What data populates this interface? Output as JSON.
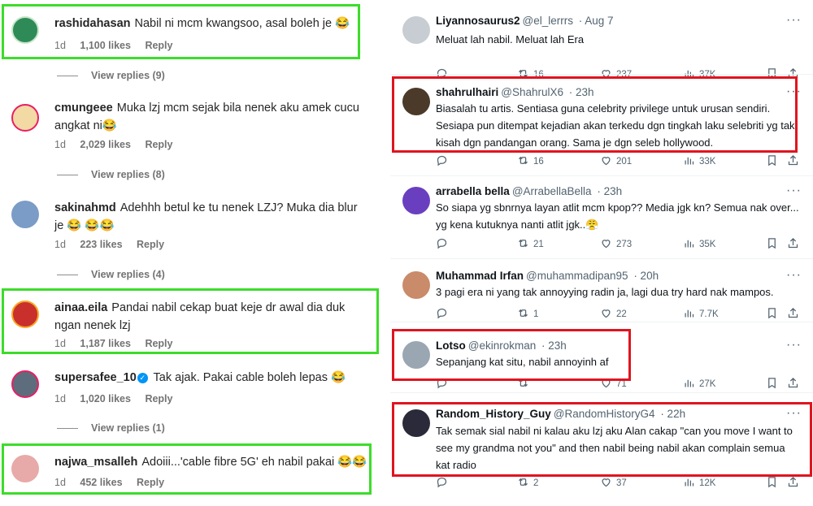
{
  "instagram": {
    "comments": [
      {
        "username": "rashidahasan",
        "text": "Nabil ni mcm kwangsoo, asal boleh je 😂",
        "time": "1d",
        "likes": "1,100 likes",
        "reply": "Reply",
        "view_replies": "View replies (9)"
      },
      {
        "username": "cmungeee",
        "text": "Muka lzj mcm sejak bila nenek aku amek cucu angkat ni😂",
        "time": "1d",
        "likes": "2,029 likes",
        "reply": "Reply",
        "view_replies": "View replies (8)"
      },
      {
        "username": "sakinahmd",
        "text": "Adehhh betul ke tu nenek LZJ? Muka dia blur je 😂 😂😂",
        "time": "1d",
        "likes": "223 likes",
        "reply": "Reply",
        "view_replies": "View replies (4)"
      },
      {
        "username": "ainaa.eila",
        "text": "Pandai nabil cekap buat keje dr awal dia duk ngan nenek lzj",
        "time": "1d",
        "likes": "1,187 likes",
        "reply": "Reply"
      },
      {
        "username": "supersafee_10",
        "text": "Tak ajak. Pakai cable boleh lepas 😂",
        "time": "1d",
        "likes": "1,020 likes",
        "reply": "Reply",
        "view_replies": "View replies (1)"
      },
      {
        "username": "najwa_msalleh",
        "text": "Adoiii...'cable fibre 5G' eh nabil pakai 😂😂",
        "time": "1d",
        "likes": "452 likes",
        "reply": "Reply"
      }
    ]
  },
  "twitter": {
    "tweets": [
      {
        "name": "Liyannosaurus2",
        "handle": "@el_lerrrs",
        "time": "· Aug 7",
        "text": "Meluat lah nabil. Meluat lah Era",
        "replies": "",
        "retweets": "16",
        "likes": "237",
        "views": "37K"
      },
      {
        "name": "shahrulhairi",
        "handle": "@ShahrulX6",
        "time": "· 23h",
        "text": "Biasalah tu artis. Sentiasa guna celebrity privilege untuk urusan sendiri. Sesiapa pun ditempat kejadian akan terkedu dgn tingkah laku selebriti yg tak kisah dgn pandangan orang. Sama je dgn seleb hollywood.",
        "replies": "",
        "retweets": "16",
        "likes": "201",
        "views": "33K"
      },
      {
        "name": "arrabella bella",
        "handle": "@ArrabellaBella",
        "time": "· 23h",
        "text": "So siapa yg sbnrnya layan atlit mcm kpop?? Media jgk kn? Semua nak over... yg kena kutuknya nanti atlit jgk..😤",
        "replies": "",
        "retweets": "21",
        "likes": "273",
        "views": "35K"
      },
      {
        "name": "Muhammad Irfan",
        "handle": "@muhammadipan95",
        "time": "· 20h",
        "text": "3 pagi era ni yang tak annoyying radin ja, lagi dua try hard nak mampos.",
        "replies": "",
        "retweets": "1",
        "likes": "22",
        "views": "7.7K"
      },
      {
        "name": "Lotso",
        "handle": "@ekinrokman",
        "time": "· 23h",
        "text": "Sepanjang kat situ, nabil annoyinh af",
        "replies": "",
        "retweets": "",
        "likes": "71",
        "views": "27K"
      },
      {
        "name": "Random_History_Guy",
        "handle": "@RandomHistoryG4",
        "time": "· 22h",
        "text": "Tak semak sial nabil ni kalau aku lzj aku Alan cakap \"can you move I want to see my grandma not you\" and then nabil being nabil akan complain semua kat radio",
        "replies": "",
        "retweets": "2",
        "likes": "37",
        "views": "12K"
      }
    ]
  },
  "colors": {
    "highlight_green": "#3ddc2b",
    "highlight_red": "#e0141f",
    "verified": "#0095f6"
  }
}
